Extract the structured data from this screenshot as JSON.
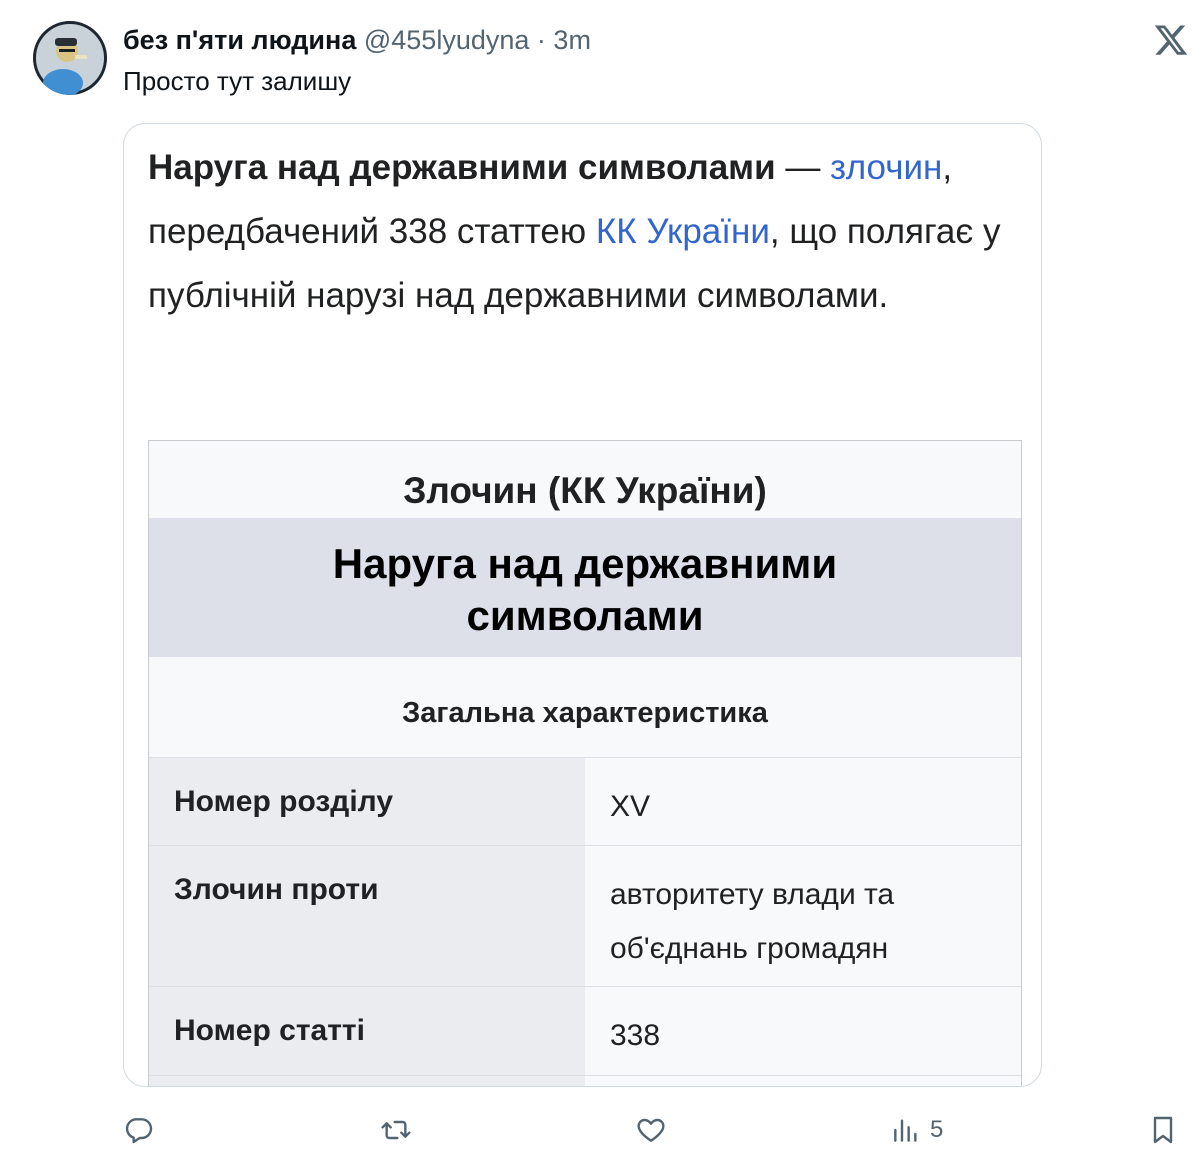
{
  "tweet": {
    "author_name": "без п'яти людина",
    "handle": "@455lyudyna",
    "separator": "·",
    "time": "3m",
    "text": "Просто тут залишу"
  },
  "card": {
    "lead": {
      "bold_term": "Наруга над державними символами",
      "dash": " — ",
      "link_crime": "злочин",
      "comma": ",",
      "text_a": " передбачений 338 статтею ",
      "link_code": "КК України",
      "text_b": ", що полягає у публічній нарузі над державними символами."
    },
    "infobox": {
      "title": "Злочин (КК України)",
      "name_line1": "Наруга над державними",
      "name_line2": "символами",
      "section": "Загальна характеристика",
      "rows": [
        {
          "label": "Номер розділу",
          "value": "XV"
        },
        {
          "label": "Злочин проти",
          "value_line1": "авторитету влади та",
          "value_line2": "об'єднань громадян"
        },
        {
          "label": "Номер статті",
          "value": "338"
        }
      ]
    }
  },
  "actions": {
    "reply_icon": "reply-icon",
    "retweet_icon": "retweet-icon",
    "like_icon": "heart-icon",
    "views_icon": "views-icon",
    "views_count": "5",
    "bookmark_icon": "bookmark-icon"
  }
}
